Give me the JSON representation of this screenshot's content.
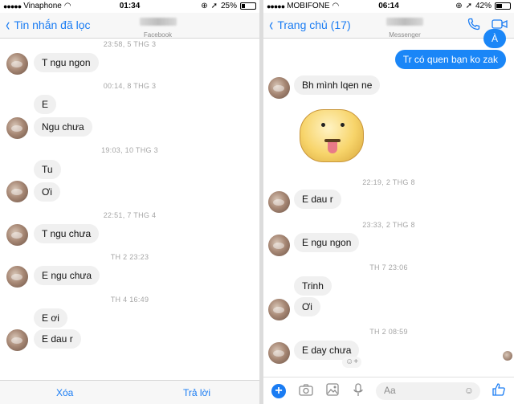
{
  "left": {
    "status": {
      "carrier": "Vinaphone",
      "time": "01:34",
      "battery": "25%",
      "battery_level": 0.25
    },
    "nav": {
      "back_label": "Tin nhắn đã lọc",
      "subtitle": "Facebook"
    },
    "items": [
      {
        "kind": "ts",
        "text": "23:58, 5 THG 3"
      },
      {
        "kind": "msg",
        "text": "T ngu ngon"
      },
      {
        "kind": "ts",
        "text": "00:14, 8 THG 3"
      },
      {
        "kind": "msg",
        "text": "E"
      },
      {
        "kind": "msg",
        "text": "Ngu chưa"
      },
      {
        "kind": "ts",
        "text": "19:03, 10 THG 3"
      },
      {
        "kind": "msg",
        "text": "Tu"
      },
      {
        "kind": "msg",
        "text": "Ơi"
      },
      {
        "kind": "ts",
        "text": "22:51, 7 THG 4"
      },
      {
        "kind": "msg",
        "text": "T ngu chưa"
      },
      {
        "kind": "ts",
        "text": "TH 2 23:23"
      },
      {
        "kind": "msg",
        "text": "E ngu chưa"
      },
      {
        "kind": "ts",
        "text": "TH 4 16:49"
      },
      {
        "kind": "msg",
        "text": "E ơi"
      },
      {
        "kind": "msg",
        "text": "E dau r"
      }
    ],
    "bottom": {
      "delete_label": "Xóa",
      "reply_label": "Trả lời"
    }
  },
  "right": {
    "status": {
      "carrier": "MOBIFONE",
      "time": "06:14",
      "battery": "42%",
      "battery_level": 0.42
    },
    "nav": {
      "back_label": "Trang chủ (17)",
      "subtitle": "Messenger"
    },
    "items": [
      {
        "kind": "out",
        "text": "À"
      },
      {
        "kind": "out",
        "text": "Tr có quen bạn ko zak"
      },
      {
        "kind": "msg",
        "text": "Bh mình lqen ne"
      },
      {
        "kind": "ts",
        "text": "22:19, 2 THG 8"
      },
      {
        "kind": "msg",
        "text": "E dau r"
      },
      {
        "kind": "ts",
        "text": "23:33, 2 THG 8"
      },
      {
        "kind": "msg",
        "text": "E ngu ngon"
      },
      {
        "kind": "ts",
        "text": "TH 7 23:06"
      },
      {
        "kind": "msg",
        "text": "Trinh"
      },
      {
        "kind": "msg",
        "text": "Ơi"
      },
      {
        "kind": "ts",
        "text": "TH 2 08:59"
      },
      {
        "kind": "msg",
        "text": "E day chưa"
      }
    ],
    "composer": {
      "placeholder": "Aa"
    }
  },
  "icons": {
    "phone": "phone-icon",
    "video": "video-camera-icon",
    "camera": "camera-icon",
    "image": "image-icon",
    "mic": "microphone-icon",
    "like": "thumbs-up-icon",
    "sticker": "tongue-out-sticker",
    "emoji": "emoji-icon"
  },
  "colors": {
    "accent": "#1a7cf3",
    "outgoing_bubble": "#1a86f7",
    "incoming_bubble": "#f0f0f0",
    "timestamp": "#a5a5a5"
  }
}
